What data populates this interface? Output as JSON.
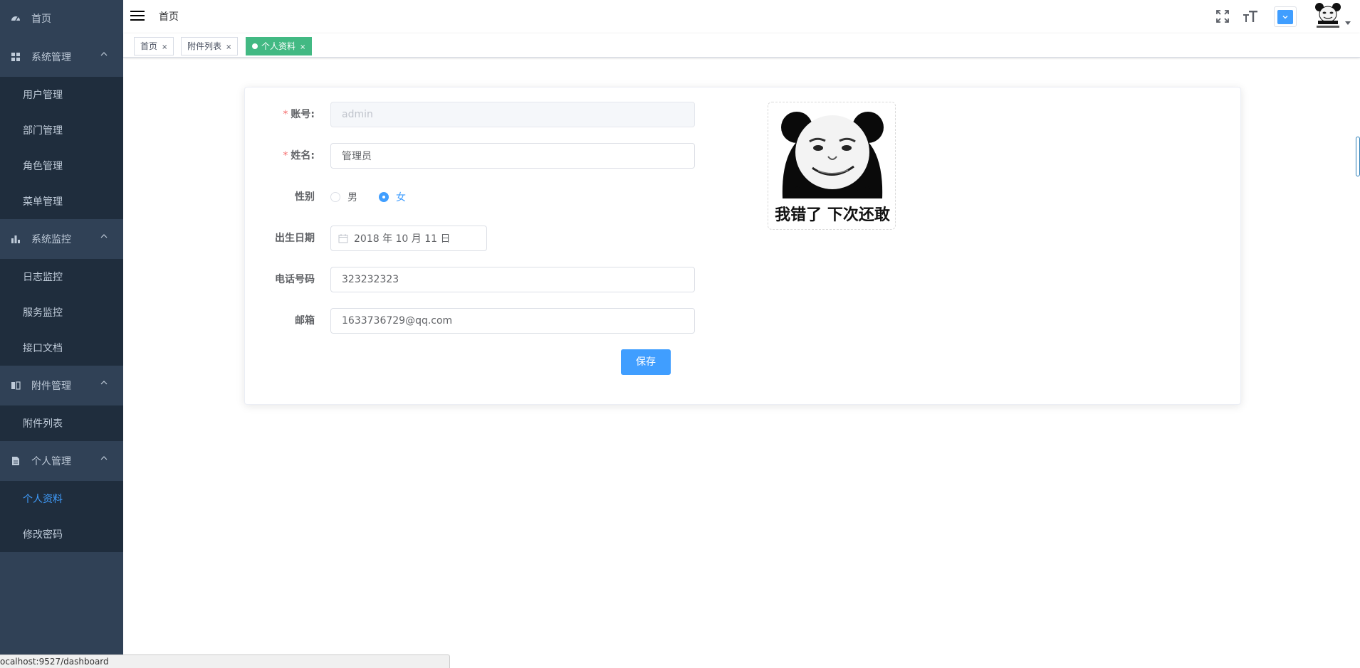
{
  "sidebar": {
    "items": [
      {
        "label": "首页",
        "icon": "dashboard-icon"
      },
      {
        "label": "系统管理",
        "icon": "grid-icon"
      },
      {
        "label": "用户管理"
      },
      {
        "label": "部门管理"
      },
      {
        "label": "角色管理"
      },
      {
        "label": "菜单管理"
      },
      {
        "label": "系统监控",
        "icon": "chart-icon"
      },
      {
        "label": "日志监控"
      },
      {
        "label": "服务监控"
      },
      {
        "label": "接口文档"
      },
      {
        "label": "附件管理",
        "icon": "book-icon"
      },
      {
        "label": "附件列表"
      },
      {
        "label": "个人管理",
        "icon": "document-icon"
      },
      {
        "label": "个人资料"
      },
      {
        "label": "修改密码"
      }
    ]
  },
  "header": {
    "breadcrumb": "首页"
  },
  "tags": [
    {
      "label": "首页"
    },
    {
      "label": "附件列表"
    },
    {
      "label": "个人资料"
    }
  ],
  "form": {
    "account_label": "账号:",
    "account_value": "admin",
    "name_label": "姓名:",
    "name_value": "管理员",
    "gender_label": "性别",
    "gender_male": "男",
    "gender_female": "女",
    "birth_label": "出生日期",
    "birth_value": "2018 年 10 月 11 日",
    "phone_label": "电话号码",
    "phone_value": "323232323",
    "email_label": "邮箱",
    "email_value": "1633736729@qq.com",
    "save_label": "保存"
  },
  "avatar_caption": "我错了 下次还敢",
  "status_url": "ocalhost:9527/dashboard",
  "colors": {
    "sidebar_bg": "#304156",
    "submenu_bg": "#1f2d3d",
    "sidebar_text": "#bfcbd9",
    "active": "#409eff",
    "tag_active": "#42b983",
    "required": "#f56c6c"
  }
}
